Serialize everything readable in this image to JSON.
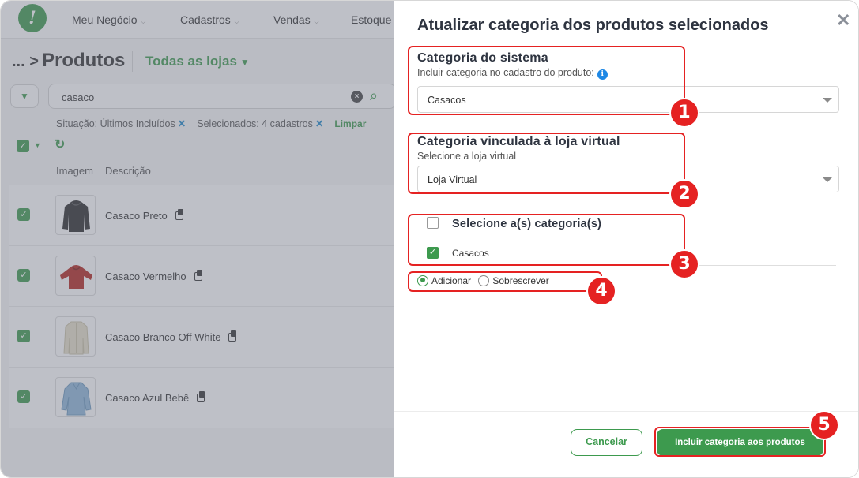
{
  "nav": {
    "logo_glyph": "!",
    "items": [
      {
        "label": "Meu Negócio"
      },
      {
        "label": "Cadastros"
      },
      {
        "label": "Vendas"
      },
      {
        "label": "Estoque"
      }
    ]
  },
  "breadcrumb": {
    "ellipsis": "...",
    "separator": ">",
    "title": "Produtos",
    "store_selector": "Todas as lojas"
  },
  "search": {
    "value": "casaco"
  },
  "filters": {
    "situation": "Situação: Últimos Incluídos",
    "selected": "Selecionados: 4 cadastros",
    "clear_label": "Limpar"
  },
  "list": {
    "columns": [
      "Imagem",
      "Descrição"
    ],
    "rows": [
      {
        "name": "Casaco Preto",
        "color": "#2b2b2b",
        "checked": true
      },
      {
        "name": "Casaco Vermelho",
        "color": "#b3261e",
        "checked": true
      },
      {
        "name": "Casaco Branco Off White",
        "color": "#e6dfc8",
        "checked": true
      },
      {
        "name": "Casaco Azul Bebê",
        "color": "#8fb7d9",
        "checked": true
      }
    ]
  },
  "modal": {
    "title": "Atualizar categoria dos produtos selecionados",
    "system_category": {
      "title": "Categoria do sistema",
      "subtitle": "Incluir categoria no cadastro do produto:",
      "value": "Casacos"
    },
    "store_category": {
      "title": "Categoria vinculada à loja virtual",
      "subtitle": "Selecione a loja virtual",
      "value": "Loja Virtual"
    },
    "categories": {
      "header": "Selecione a(s) categoria(s)",
      "items": [
        {
          "label": "Casacos",
          "checked": true
        }
      ]
    },
    "mode": {
      "options": [
        "Adicionar",
        "Sobrescrever"
      ],
      "selected": "Adicionar"
    },
    "buttons": {
      "cancel": "Cancelar",
      "confirm": "Incluir categoria aos produtos"
    }
  },
  "annotations": [
    "1",
    "2",
    "3",
    "4",
    "5"
  ],
  "colors": {
    "accent": "#3d9a4e",
    "annotation": "#e52222",
    "info": "#1e88e5"
  }
}
